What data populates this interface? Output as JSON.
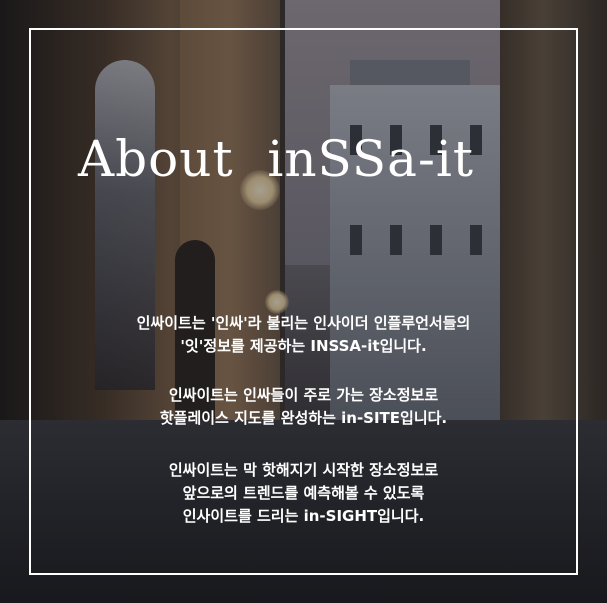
{
  "title": "About  inSSa-it",
  "paragraphs": [
    {
      "lines": [
        "인싸이트는 '인싸'라 불리는 인사이더 인플루언서들의",
        "'잇'정보를 제공하는 INSSA-it입니다."
      ]
    },
    {
      "lines": [
        "인싸이트는 인싸들이 주로 가는 장소정보로",
        "핫플레이스 지도를 완성하는 in-SITE입니다."
      ]
    },
    {
      "lines": [
        "인싸이트는 막 핫해지기 시작한 장소정보로",
        "앞으로의 트렌드를 예측해볼 수 있도록",
        "인사이트를  드리는 in-SIGHT입니다."
      ]
    }
  ],
  "colors": {
    "text": "#ffffff",
    "frame": "#ffffff",
    "overlay": "rgba(20,20,26,0.38)"
  }
}
